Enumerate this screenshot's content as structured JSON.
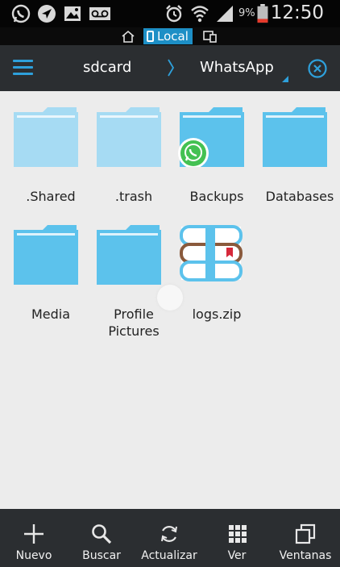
{
  "status_bar": {
    "battery_percent": "9%",
    "time": "12:50",
    "icons": [
      "whatsapp-icon",
      "navigation-icon",
      "gallery-icon",
      "voicemail-icon",
      "alarm-icon",
      "wifi-icon",
      "signal-icon",
      "battery-icon"
    ]
  },
  "location": {
    "home_icon": "home-icon",
    "label": "Local",
    "devices_icon": "devices-icon"
  },
  "toolbar": {
    "menu_icon": "menu-icon",
    "breadcrumb": [
      "sdcard",
      "WhatsApp"
    ],
    "close_icon": "close-icon"
  },
  "files": [
    {
      "name": ".Shared",
      "type": "folder",
      "style": "faded"
    },
    {
      "name": ".trash",
      "type": "folder",
      "style": "faded"
    },
    {
      "name": "Backups",
      "type": "folder",
      "style": "normal",
      "badge": "whatsapp-icon"
    },
    {
      "name": "Databases",
      "type": "folder",
      "style": "normal"
    },
    {
      "name": "Media",
      "type": "folder",
      "style": "normal"
    },
    {
      "name": "Profile\nPictures",
      "type": "folder",
      "style": "normal"
    },
    {
      "name": "logs.zip",
      "type": "archive",
      "style": "zip"
    }
  ],
  "bottom_bar": [
    {
      "label": "Nuevo",
      "icon": "plus-icon"
    },
    {
      "label": "Buscar",
      "icon": "search-icon"
    },
    {
      "label": "Actualizar",
      "icon": "refresh-icon"
    },
    {
      "label": "Ver",
      "icon": "grid-icon"
    },
    {
      "label": "Ventanas",
      "icon": "windows-icon"
    }
  ],
  "colors": {
    "accent": "#2ea0db",
    "folder": "#5cc2ec",
    "folder_faded": "#a6dbf3",
    "toolbar": "#2b2e31",
    "background": "#ececec"
  }
}
